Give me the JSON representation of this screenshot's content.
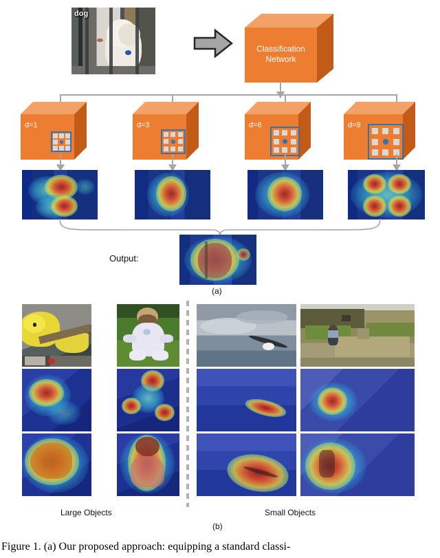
{
  "figure": {
    "caption": "Figure 1. (a) Our proposed approach: equipping a standard classi-",
    "panel_a_label": "(a)",
    "panel_b_label": "(b)"
  },
  "panel_a": {
    "input": {
      "class_label": "dog",
      "alt": "photo of a white dog behind metal bars"
    },
    "arrow_icon": "right-block-arrow-icon",
    "network": {
      "title": "Classification\nNetwork",
      "color": "#ED7D31"
    },
    "dilation_blocks": [
      {
        "label": "d=1",
        "dilation": 1,
        "kernel": "3x3",
        "patch_size": "small"
      },
      {
        "label": "d=3",
        "dilation": 3,
        "kernel": "3x3",
        "patch_size": "medium"
      },
      {
        "label": "d=6",
        "dilation": 6,
        "kernel": "3x3",
        "patch_size": "large"
      },
      {
        "label": "d=9",
        "dilation": 9,
        "kernel": "3x3",
        "patch_size": "xlarge"
      }
    ],
    "attention_maps": [
      {
        "for": "d=1",
        "alt": "attention map with two separate hot spots on dog head and body"
      },
      {
        "for": "d=3",
        "alt": "attention map with single vertical hot region over the dog"
      },
      {
        "for": "d=6",
        "alt": "attention map with broad hot region over the dog"
      },
      {
        "for": "d=9",
        "alt": "attention map spread to four hot lobes beyond the dog"
      }
    ],
    "output": {
      "label": "Output:",
      "alt": "fused attention map covering the whole dog"
    },
    "colors": {
      "connector": "#A6A6A6",
      "kernel_border": "#2E75B6",
      "kernel_cell": "#D9D9D9",
      "box_face": "#ED7D31",
      "box_top": "#F2A268",
      "box_side": "#C25A18"
    }
  },
  "panel_b": {
    "group_left_label": "Large Objects",
    "group_right_label": "Small Objects",
    "row_names": [
      "input-image",
      "baseline-attention-map",
      "proposed-attention-map"
    ],
    "columns": [
      {
        "group": "large",
        "subject": "yellow parakeet on a branch"
      },
      {
        "group": "large",
        "subject": "baby sitting on grass"
      },
      {
        "group": "small",
        "subject": "seagull flying in a cloudy sky"
      },
      {
        "group": "small",
        "subject": "child running on a stone ruin path"
      }
    ]
  }
}
